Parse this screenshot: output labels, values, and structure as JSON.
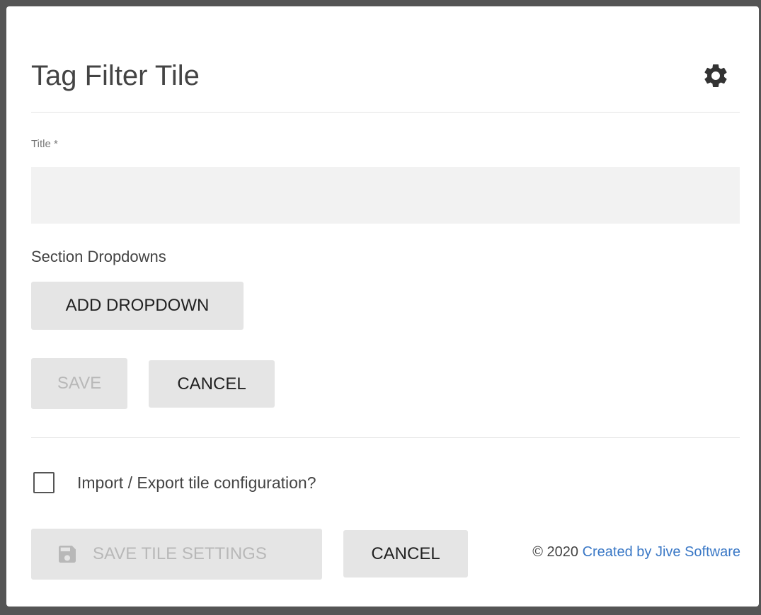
{
  "dialog": {
    "title": "Tag Filter Tile",
    "settings_icon": "gear-icon"
  },
  "form": {
    "title_label": "Title *",
    "title_value": "",
    "title_placeholder": "",
    "section_label": "Section Dropdowns",
    "add_dropdown_label": "ADD DROPDOWN",
    "save_label": "SAVE",
    "save_disabled": true,
    "cancel_label": "CANCEL"
  },
  "import_export": {
    "checkbox_label": "Import / Export tile configuration?",
    "checked": false
  },
  "footer": {
    "save_settings_label": "SAVE TILE SETTINGS",
    "save_settings_icon": "floppy-disk-icon",
    "save_settings_disabled": true,
    "cancel_label": "CANCEL",
    "copyright": "© 2020",
    "credit_link": "Created by Jive Software",
    "link_color": "#3a78c6"
  }
}
